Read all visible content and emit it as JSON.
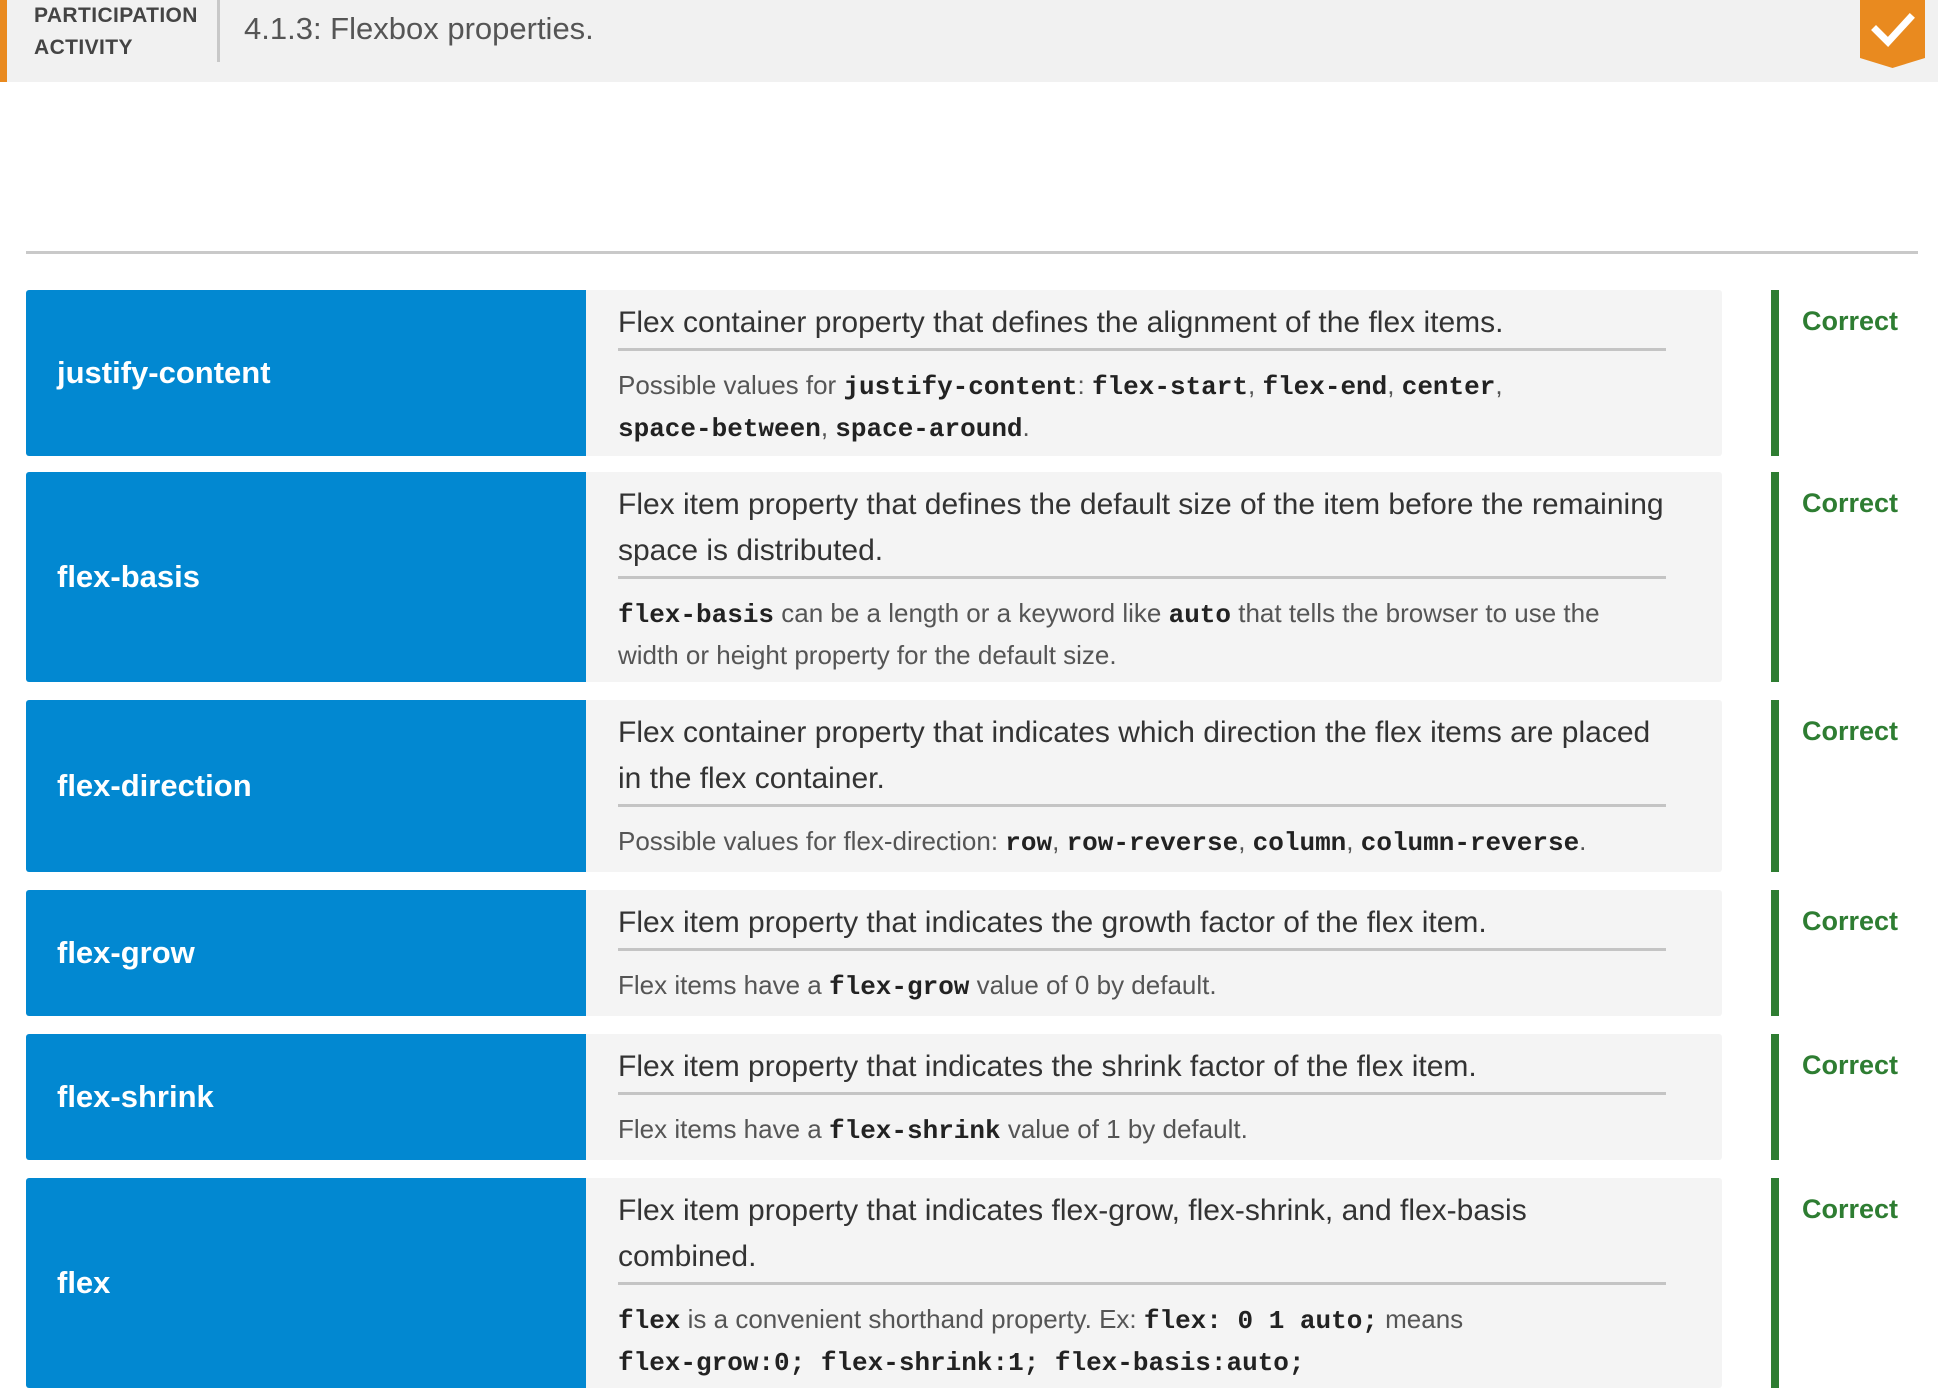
{
  "header": {
    "label_line1": "PARTICIPATION",
    "label_line2": "ACTIVITY",
    "title": "4.1.3: Flexbox properties."
  },
  "colors": {
    "accent": "#e98a1f",
    "term_bg": "#0288d1",
    "correct": "#2e7d32"
  },
  "rows": [
    {
      "term": "justify-content",
      "main": "Flex container property that defines the alignment of the flex items.",
      "note": {
        "t0": "Possible values for ",
        "c0": "justify-content",
        "t1": ": ",
        "c1": "flex-start",
        "t2": ", ",
        "c2": "flex-end",
        "t3": ", ",
        "c3": "center",
        "t4": ", ",
        "c4": "space-between",
        "t5": ", ",
        "c5": "space-around",
        "t6": "."
      },
      "result": "Correct"
    },
    {
      "term": "flex-basis",
      "main": "Flex item property that defines the default size of the item before the remaining space is distributed.",
      "note": {
        "c0": "flex-basis",
        "t0": " can be a length or a keyword like ",
        "c1": "auto",
        "t1": " that tells the browser to use the width or height property for the default size."
      },
      "result": "Correct"
    },
    {
      "term": "flex-direction",
      "main": "Flex container property that indicates which direction the flex items are placed in the flex container.",
      "note": {
        "t0": "Possible values for flex-direction: ",
        "c0": "row",
        "t1": ", ",
        "c1": "row-reverse",
        "t2": ", ",
        "c2": "column",
        "t3": ", ",
        "c3": "column-reverse",
        "t4": "."
      },
      "result": "Correct"
    },
    {
      "term": "flex-grow",
      "main": "Flex item property that indicates the growth factor of the flex item.",
      "note": {
        "t0": "Flex items have a ",
        "c0": "flex-grow",
        "t1": " value of 0 by default."
      },
      "result": "Correct"
    },
    {
      "term": "flex-shrink",
      "main": "Flex item property that indicates the shrink factor of the flex item.",
      "note": {
        "t0": "Flex items have a ",
        "c0": "flex-shrink",
        "t1": " value of 1 by default."
      },
      "result": "Correct"
    },
    {
      "term": "flex",
      "main": "Flex item property that indicates flex-grow, flex-shrink, and flex-basis combined.",
      "note": {
        "c0": "flex",
        "t0": " is a convenient shorthand property. Ex: ",
        "c1": "flex: 0 1 auto;",
        "t1": " means ",
        "c2": "flex-grow:0; flex-shrink:1; flex-basis:auto;"
      },
      "result": "Correct"
    }
  ]
}
